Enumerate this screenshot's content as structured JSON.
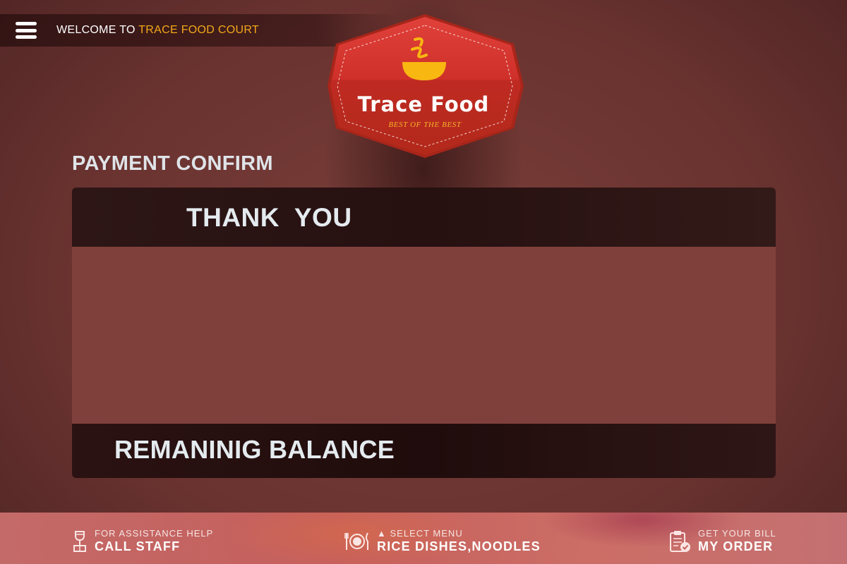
{
  "header": {
    "menu_icon": "hamburger-menu-icon",
    "welcome_prefix": "WELCOME TO",
    "welcome_brand": "TRACE FOOD COURT"
  },
  "logo": {
    "icon": "steaming-bowl-icon",
    "title": "Trace Food",
    "tagline": "BEST OF THE BEST"
  },
  "main": {
    "page_title": "PAYMENT CONFIRM",
    "thank_you": "THANK  YOU",
    "balance_label": "REMANINIG BALANCE"
  },
  "footer": {
    "assistance": {
      "icon": "wine-glass-icon",
      "caption": "FOR ASSISTANCE HELP",
      "label": "CALL STAFF"
    },
    "menu": {
      "icon": "plate-cutlery-icon",
      "caption": "▲ SELECT MENU",
      "label": "RICE DISHES,NOODLES"
    },
    "order": {
      "icon": "clipboard-check-icon",
      "caption": "GET YOUR BILL",
      "label": "MY ORDER"
    }
  },
  "colors": {
    "accent": "#f3a81b",
    "badge_red": "#c9302a",
    "background": "#6a3330",
    "panel_dark": "#261010",
    "footer": "#c55f5c"
  }
}
